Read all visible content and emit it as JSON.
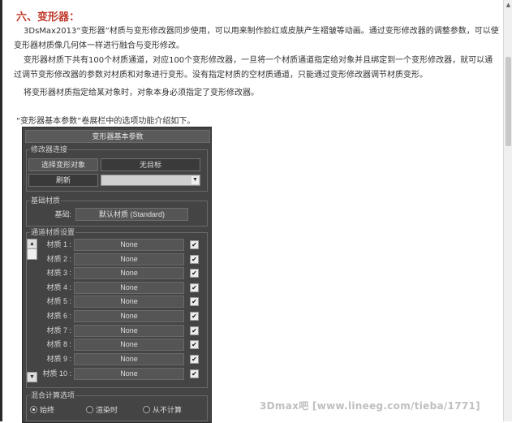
{
  "heading": "六、变形器：",
  "paragraphs": [
    "3DsMax2013“变形器”材质与变形修改器同步使用，可以用来制作脸红或皮肤产生褶皱等动画。通过变形修改器的调整参数，可以使变形器材质像几何体一样进行融合与变形修改。",
    "变形器材质下共有100个材质通道，对应100个变形修改器，一旦将一个材质通道指定给对象并且绑定到一个变形修改器，就可以通过调节变形修改器的参数对材质和对象进行变形。没有指定材质的空材质通道，只能通过变形修改器调节材质变形。",
    "将变形器材质指定给某对象时，对象本身必须指定了变形修改器。"
  ],
  "caption": "“变形器基本参数”卷展栏中的选项功能介绍如下。",
  "panel": {
    "title": "变形器基本参数",
    "modifier_group": {
      "label": "修改器连接",
      "select_button": "选择变形对象",
      "target_button": "无目标",
      "refresh_button": "刷新",
      "dropdown_value": ""
    },
    "base_group": {
      "label": "基础材质",
      "base_label": "基础:",
      "base_button": "默认材质 (Standard)"
    },
    "channel_group": {
      "label": "通道材质设置",
      "channels": [
        {
          "label": "材质 1 :",
          "value": "None",
          "checked": true
        },
        {
          "label": "材质 2 :",
          "value": "None",
          "checked": true
        },
        {
          "label": "材质 3 :",
          "value": "None",
          "checked": true
        },
        {
          "label": "材质 4 :",
          "value": "None",
          "checked": true
        },
        {
          "label": "材质 5 :",
          "value": "None",
          "checked": true
        },
        {
          "label": "材质 6 :",
          "value": "None",
          "checked": true
        },
        {
          "label": "材质 7 :",
          "value": "None",
          "checked": true
        },
        {
          "label": "材质 8 :",
          "value": "None",
          "checked": true
        },
        {
          "label": "材质 9 :",
          "value": "None",
          "checked": true
        },
        {
          "label": "材质 10 :",
          "value": "None",
          "checked": true
        }
      ]
    },
    "mix_group": {
      "label": "混合计算选项",
      "options": [
        "始终",
        "渲染时",
        "从不计算"
      ],
      "selected": 0
    }
  },
  "watermark": "3Dmax吧 [www.lineeg.com/tieba/1771]"
}
